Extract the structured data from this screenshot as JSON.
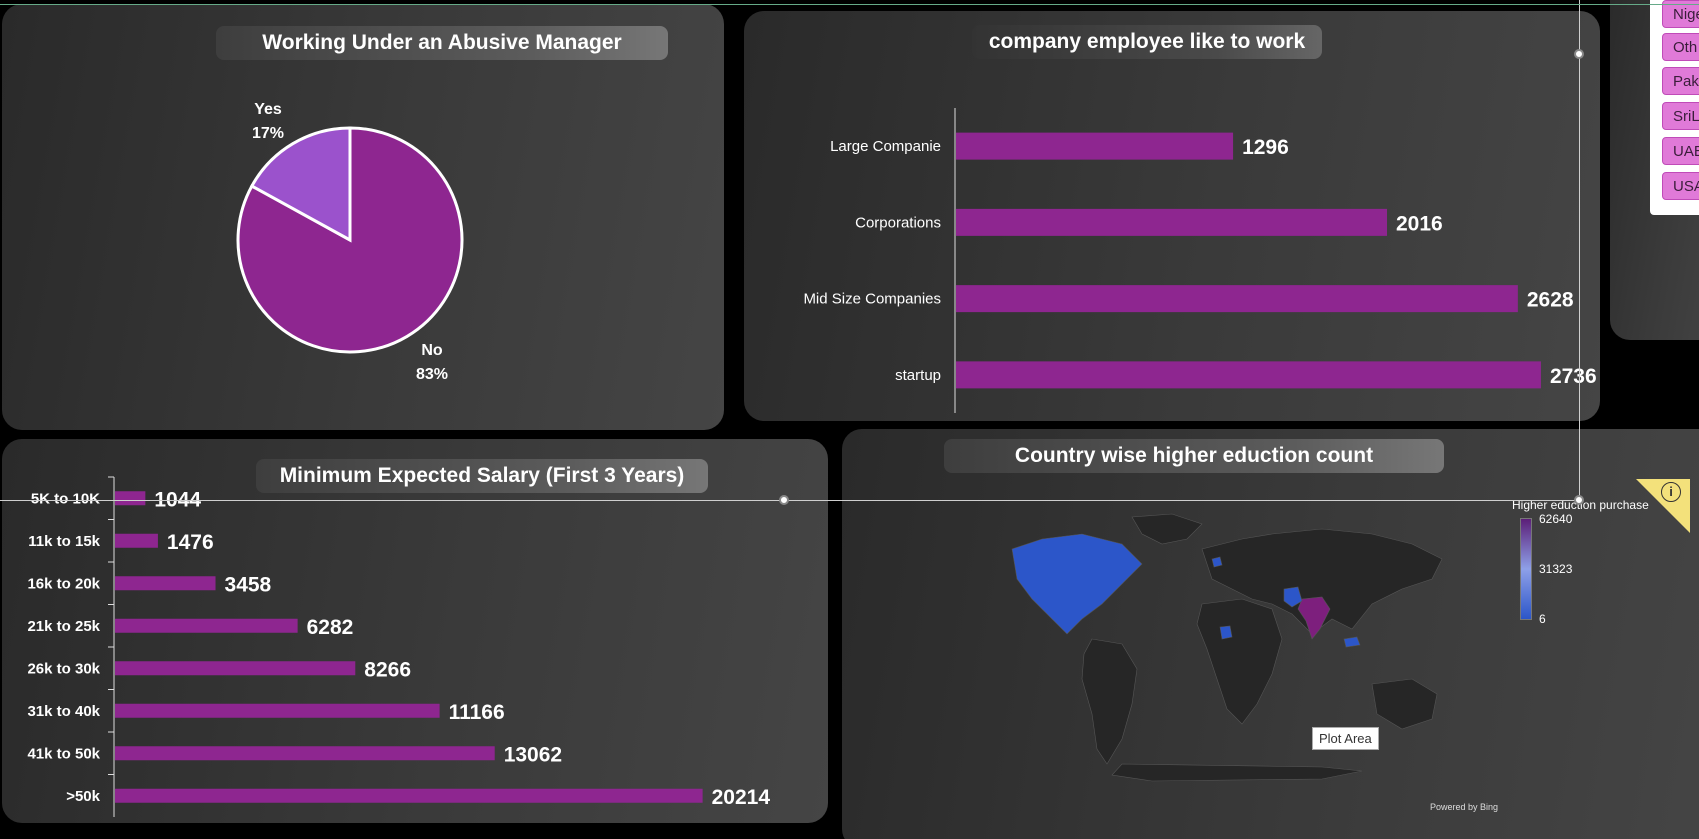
{
  "pie_panel": {
    "title": "Working Under an Abusive Manager"
  },
  "company_panel": {
    "title": "company employee like to work"
  },
  "salary_panel": {
    "title": "Minimum Expected Salary (First 3 Years)"
  },
  "map_panel": {
    "title": "Country wise higher eduction  count",
    "legend_title": "Higher eduction purchase",
    "legend_max": "62640",
    "legend_mid": "31323",
    "legend_min": "6",
    "plot_area_label": "Plot Area",
    "powered_by": "Powered by Bing",
    "info_icon": "info-icon",
    "highlight_colors": {
      "low": "#2f56c7",
      "high": "#7d1f7d"
    }
  },
  "slicer": {
    "items": [
      "Nige",
      "Oth",
      "Pak",
      "SriL",
      "UAE",
      "USA"
    ]
  },
  "colors": {
    "bar": "#8e2690",
    "pie_no": "#8e2690",
    "pie_yes": "#9b52cc"
  },
  "chart_data": [
    {
      "type": "pie",
      "title": "Working Under an Abusive Manager",
      "slices": [
        {
          "label": "Yes",
          "pct_label": "17%",
          "value": 17
        },
        {
          "label": "No",
          "pct_label": "83%",
          "value": 83
        }
      ]
    },
    {
      "type": "bar",
      "orientation": "horizontal",
      "title": "company employee like to work",
      "categories": [
        "Large Companie",
        "Corporations",
        "Mid Size Companies",
        "startup"
      ],
      "values": [
        1296,
        2016,
        2628,
        2736
      ],
      "xlim": [
        0,
        2900
      ]
    },
    {
      "type": "bar",
      "orientation": "horizontal",
      "title": "Minimum Expected Salary (First 3 Years)",
      "categories": [
        "5K to 10K",
        "11k to 15k",
        "16k to 20k",
        "21k to 25k",
        "26k to 30k",
        "31k to 40k",
        "41k to 50k",
        ">50k"
      ],
      "values": [
        1044,
        1476,
        3458,
        6282,
        8266,
        11166,
        13062,
        20214
      ],
      "xlim": [
        0,
        21500
      ]
    }
  ]
}
